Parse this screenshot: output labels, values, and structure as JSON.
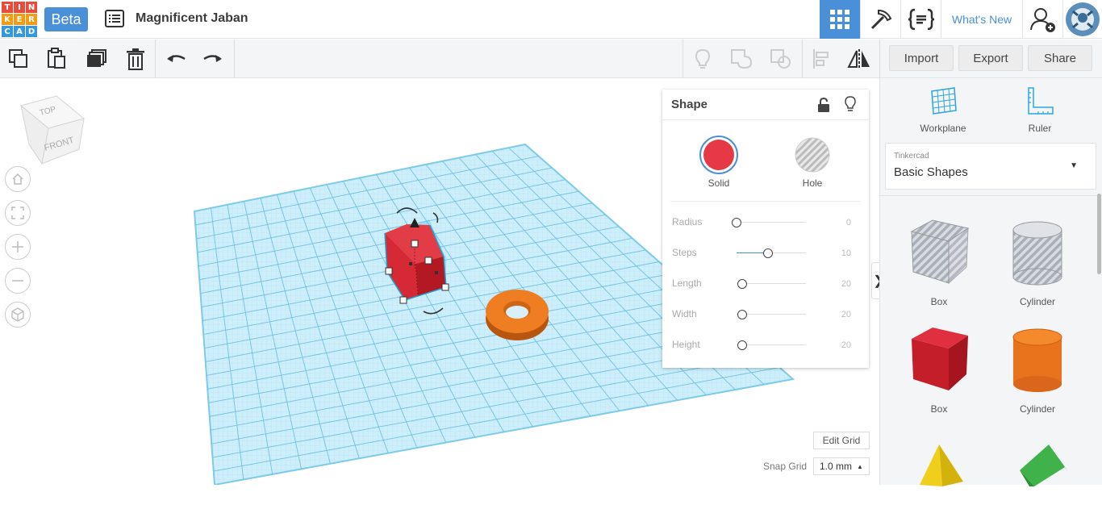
{
  "header": {
    "logo_letters": [
      "T",
      "I",
      "N",
      "K",
      "E",
      "R",
      "C",
      "A",
      "D"
    ],
    "logo_colors": [
      "#e84c3d",
      "#e84c3d",
      "#e84c3d",
      "#f39c12",
      "#f39c12",
      "#f39c12",
      "#3498db",
      "#3498db",
      "#3498db"
    ],
    "beta_label": "Beta",
    "project_title": "Magnificent Jaban",
    "whats_new": "What's New",
    "icons": [
      "design-list-icon",
      "grid-view-icon",
      "pickaxe-icon",
      "codeblocks-icon",
      "invite-user-icon",
      "avatar"
    ]
  },
  "toolbar": {
    "icons": [
      "copy-icon",
      "paste-icon",
      "duplicate-icon",
      "delete-icon",
      "undo-icon",
      "redo-icon",
      "light-icon",
      "group-icon",
      "ungroup-icon",
      "align-icon",
      "mirror-icon"
    ],
    "import_label": "Import",
    "export_label": "Export",
    "share_label": "Share"
  },
  "viewcube": {
    "top": "TOP",
    "front": "FRONT"
  },
  "shape_panel": {
    "title": "Shape",
    "solid_label": "Solid",
    "hole_label": "Hole",
    "solid_color": "#e63946",
    "properties": [
      {
        "name": "Radius",
        "value": "0",
        "level": 0.0
      },
      {
        "name": "Steps",
        "value": "10",
        "level": 0.45
      },
      {
        "name": "Length",
        "value": "20",
        "level": 0.08
      },
      {
        "name": "Width",
        "value": "20",
        "level": 0.08
      },
      {
        "name": "Height",
        "value": "20",
        "level": 0.08
      }
    ]
  },
  "grid_controls": {
    "edit_grid": "Edit Grid",
    "snap_label": "Snap Grid",
    "snap_value": "1.0 mm"
  },
  "sidebar": {
    "workplane_label": "Workplane",
    "ruler_label": "Ruler",
    "library_source": "Tinkercad",
    "library_name": "Basic Shapes",
    "shapes": [
      {
        "label": "Box",
        "kind": "box-hole"
      },
      {
        "label": "Cylinder",
        "kind": "cylinder-hole"
      },
      {
        "label": "Box",
        "kind": "box-solid"
      },
      {
        "label": "Cylinder",
        "kind": "cylinder-solid"
      },
      {
        "label": "",
        "kind": "pyramid"
      },
      {
        "label": "",
        "kind": "roof"
      }
    ]
  },
  "accent_color": "#4a90d9"
}
